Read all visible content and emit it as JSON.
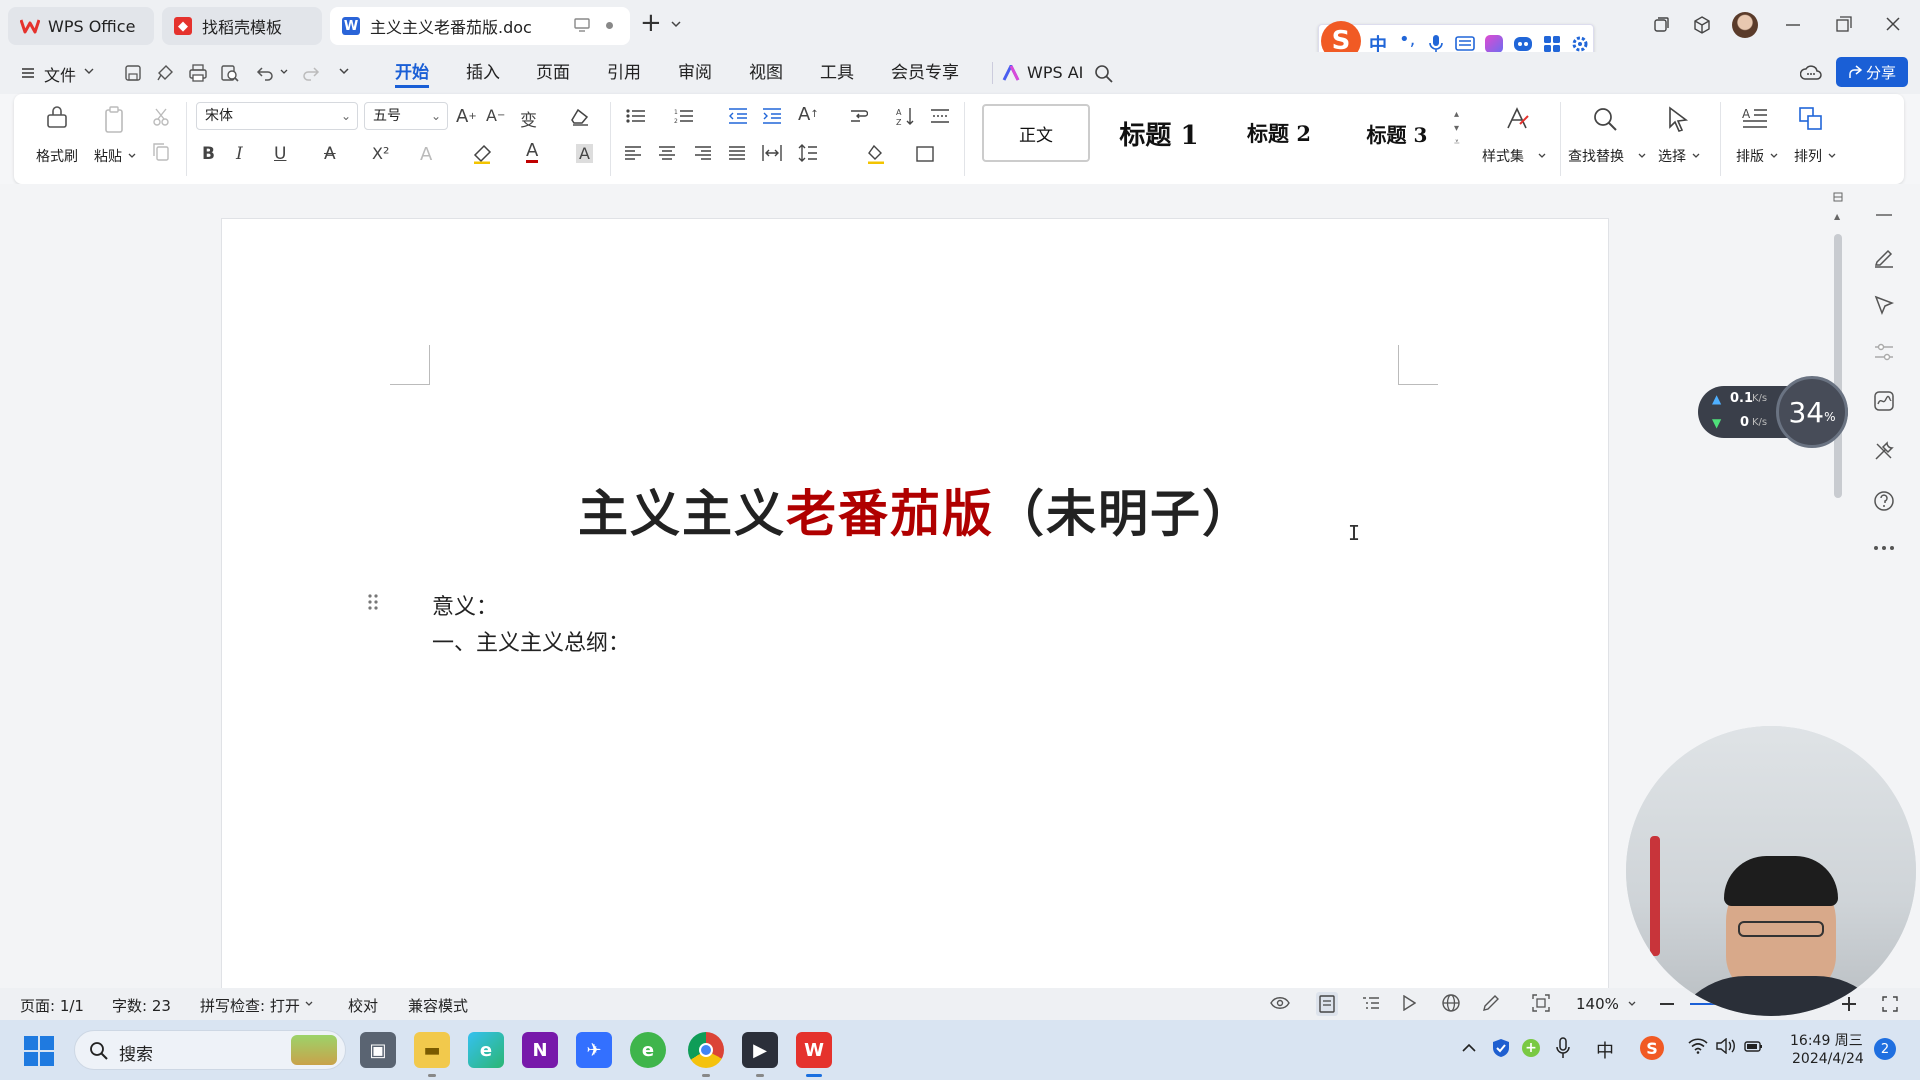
{
  "titlebar": {
    "tabs": [
      {
        "label": "WPS Office"
      },
      {
        "label": "找稻壳模板"
      },
      {
        "label": "主义主义老番茄版.doc"
      }
    ],
    "new_tab_symbol": "+"
  },
  "menubar": {
    "file_label": "文件",
    "tabs": [
      "开始",
      "插入",
      "页面",
      "引用",
      "审阅",
      "视图",
      "工具",
      "会员专享"
    ],
    "wps_ai_label": "WPS AI",
    "share_label": "分享"
  },
  "ribbon": {
    "format_painter_label": "格式刷",
    "paste_label": "粘贴",
    "font_name": "宋体",
    "font_size": "五号",
    "styles": [
      "正文",
      "标题 1",
      "标题 2",
      "标题 3"
    ],
    "style_set_label": "样式集",
    "find_replace_label": "查找替换",
    "select_label": "选择",
    "layout_label": "排版",
    "arrange_label": "排列",
    "bold_glyph": "B",
    "italic_glyph": "I",
    "underline_glyph": "U",
    "strike_glyph": "A",
    "superscript_glyph": "X²",
    "font_color_glyph": "A",
    "char_shade_glyph": "A",
    "font_color": "#c00000"
  },
  "ime_bar": {
    "lang": "中",
    "punct": "•,"
  },
  "document": {
    "title_part1": "主义主义",
    "title_part2": "老番茄版",
    "title_part3": "（未明子）",
    "title_accent_color": "#b00000",
    "para1": "意义：",
    "para2": "一、主义主义总纲："
  },
  "net_widget": {
    "upload_speed": "0.1",
    "upload_unit": "K/s",
    "download_speed": "0",
    "download_unit": "K/s",
    "percent": "34",
    "percent_unit": "%"
  },
  "statusbar": {
    "page": "页面: 1/1",
    "word_count": "字数: 23",
    "spell_check": "拼写检查: 打开",
    "proofread": "校对",
    "compat_mode": "兼容模式",
    "zoom": "140%"
  },
  "taskbar": {
    "search_label": "搜索",
    "input_lang": "中",
    "time": "16:49 周三",
    "date": "2024/4/24",
    "notification_count": "2"
  },
  "colors": {
    "accent": "#1a5fd6",
    "wps_red": "#e5322d"
  }
}
